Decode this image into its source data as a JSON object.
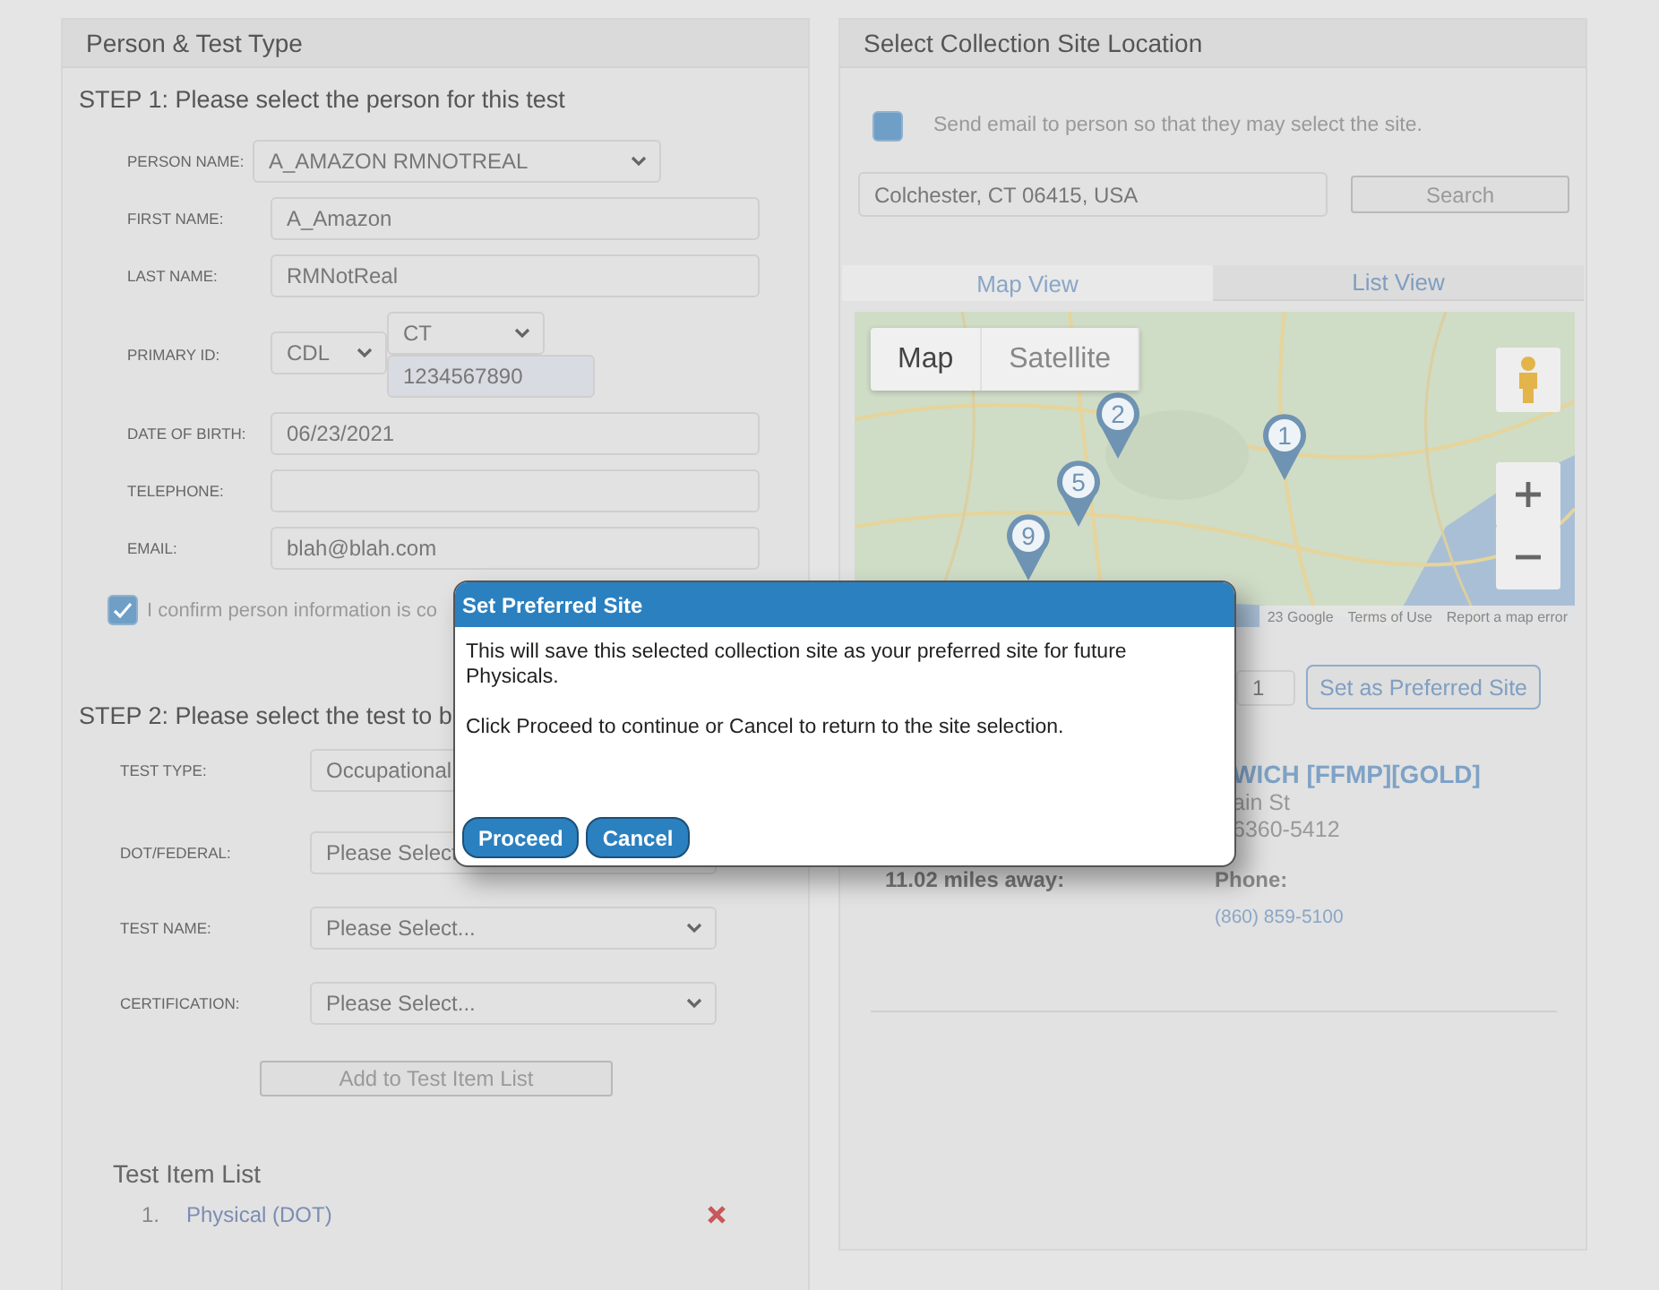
{
  "left_panel": {
    "title": "Person & Test Type",
    "step1_heading": "STEP 1: Please select the person for this test",
    "person_fields": [
      {
        "label": "PERSON NAME:",
        "kind": "select",
        "value": "A_AMAZON RMNOTREAL"
      },
      {
        "label": "FIRST NAME:",
        "kind": "input",
        "value": "A_Amazon"
      },
      {
        "label": "LAST NAME:",
        "kind": "input",
        "value": "RMNotReal"
      },
      {
        "label": "PRIMARY ID:",
        "kind": "id",
        "id_type": "CDL",
        "state": "CT",
        "number": "1234567890"
      },
      {
        "label": "DATE OF BIRTH:",
        "kind": "input",
        "value": "06/23/2021"
      },
      {
        "label": "TELEPHONE:",
        "kind": "input"
      },
      {
        "label": "EMAIL:",
        "kind": "input",
        "value": "blah@blah.com"
      }
    ],
    "confirm": {
      "label": "I confirm person information is co",
      "checked": true
    },
    "step2_heading": "STEP 2: Please select the test to b",
    "test_fields": [
      {
        "label": "TEST TYPE:",
        "value": "Occupational"
      },
      {
        "label": "DOT/FEDERAL:",
        "value": "Please Select"
      },
      {
        "label": "TEST NAME:",
        "value": "Please Select..."
      },
      {
        "label": "CERTIFICATION:",
        "value": "Please Select..."
      }
    ],
    "add_button": "Add to Test Item List",
    "test_list": {
      "title": "Test Item List",
      "items": [
        {
          "number": "1.",
          "name": "Physical (DOT)"
        }
      ]
    }
  },
  "right_panel": {
    "title": "Select Collection Site Location",
    "email_option": {
      "label": "Send email to person so that they may select the site.",
      "checked": false
    },
    "search": {
      "value": "Colchester, CT 06415, USA",
      "button": "Search"
    },
    "tabs": [
      {
        "label": "Map View",
        "selected": true
      },
      {
        "label": "List View",
        "selected": false
      }
    ],
    "map": {
      "controls": [
        {
          "label": "Map",
          "selected": true
        },
        {
          "label": "Satellite",
          "selected": false
        }
      ],
      "markers": [
        {
          "label": "1"
        },
        {
          "label": "2"
        },
        {
          "label": "5"
        },
        {
          "label": "9"
        }
      ],
      "footer": [
        "23 Google",
        "Terms of Use",
        "Report a map error"
      ]
    },
    "preferred": {
      "count": "1",
      "button": "Set as Preferred Site"
    },
    "site": {
      "name": "WICH [FFMP][GOLD]",
      "address_lines": [
        "ain St",
        "6360-5412"
      ],
      "distance": "11.02 miles away:",
      "phone_label": "Phone:",
      "phone": "(860) 859-5100"
    }
  },
  "modal": {
    "title": "Set Preferred Site",
    "paragraphs": [
      "This will save this selected collection site as your preferred site for future Physicals.",
      "Click Proceed to continue or Cancel to return to the site selection."
    ],
    "buttons": [
      "Proceed",
      "Cancel"
    ]
  }
}
